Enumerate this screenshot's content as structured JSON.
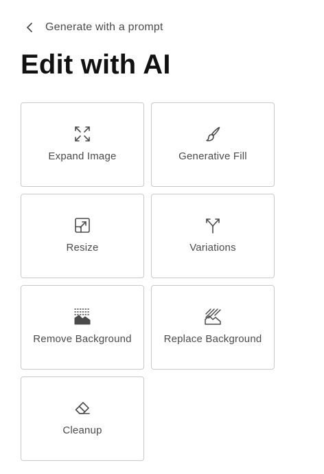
{
  "nav": {
    "back_label": "Generate with a prompt",
    "back_icon": "chevron-left-icon"
  },
  "page": {
    "title": "Edit with AI"
  },
  "tools": [
    {
      "label": "Expand Image",
      "icon": "expand-icon"
    },
    {
      "label": "Generative Fill",
      "icon": "brush-icon"
    },
    {
      "label": "Resize",
      "icon": "resize-icon"
    },
    {
      "label": "Variations",
      "icon": "fork-icon"
    },
    {
      "label": "Remove Background",
      "icon": "remove-background-icon"
    },
    {
      "label": "Replace Background",
      "icon": "replace-background-icon"
    },
    {
      "label": "Cleanup",
      "icon": "eraser-icon"
    }
  ],
  "colors": {
    "text": "#111111",
    "muted_text": "#4a4a4a",
    "border": "#c9c9c9",
    "icon": "#4a4a4a"
  }
}
